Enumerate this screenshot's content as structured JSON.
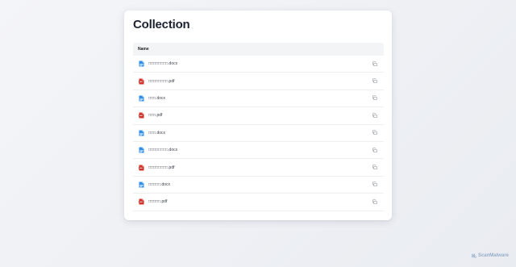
{
  "page": {
    "title": "Collection"
  },
  "table": {
    "header": "Name",
    "rows": [
      {
        "name": "□□□□□□□□.docx",
        "type": "docx",
        "icon": "docx-file-icon"
      },
      {
        "name": "□□□□□□□□.pdf",
        "type": "pdf",
        "icon": "pdf-file-icon"
      },
      {
        "name": "□□□.docx",
        "type": "docx",
        "icon": "docx-file-icon"
      },
      {
        "name": "□□□.pdf",
        "type": "pdf",
        "icon": "pdf-file-icon"
      },
      {
        "name": "□□□.docx",
        "type": "docx",
        "icon": "docx-file-icon"
      },
      {
        "name": "□□□□□□□□.docx",
        "type": "docx",
        "icon": "docx-file-icon"
      },
      {
        "name": "□□□□□□□□.pdf",
        "type": "pdf",
        "icon": "pdf-file-icon"
      },
      {
        "name": "□□□□□.docx",
        "type": "docx",
        "icon": "docx-file-icon"
      },
      {
        "name": "□□□□□.pdf",
        "type": "pdf",
        "icon": "pdf-file-icon"
      }
    ]
  },
  "watermark": {
    "text": "ScanMalware"
  },
  "colors": {
    "docx": "#2f8fe8",
    "pdf": "#d9342b",
    "copy_icon": "#8a8f98",
    "watermark": "#8fa7c6"
  }
}
